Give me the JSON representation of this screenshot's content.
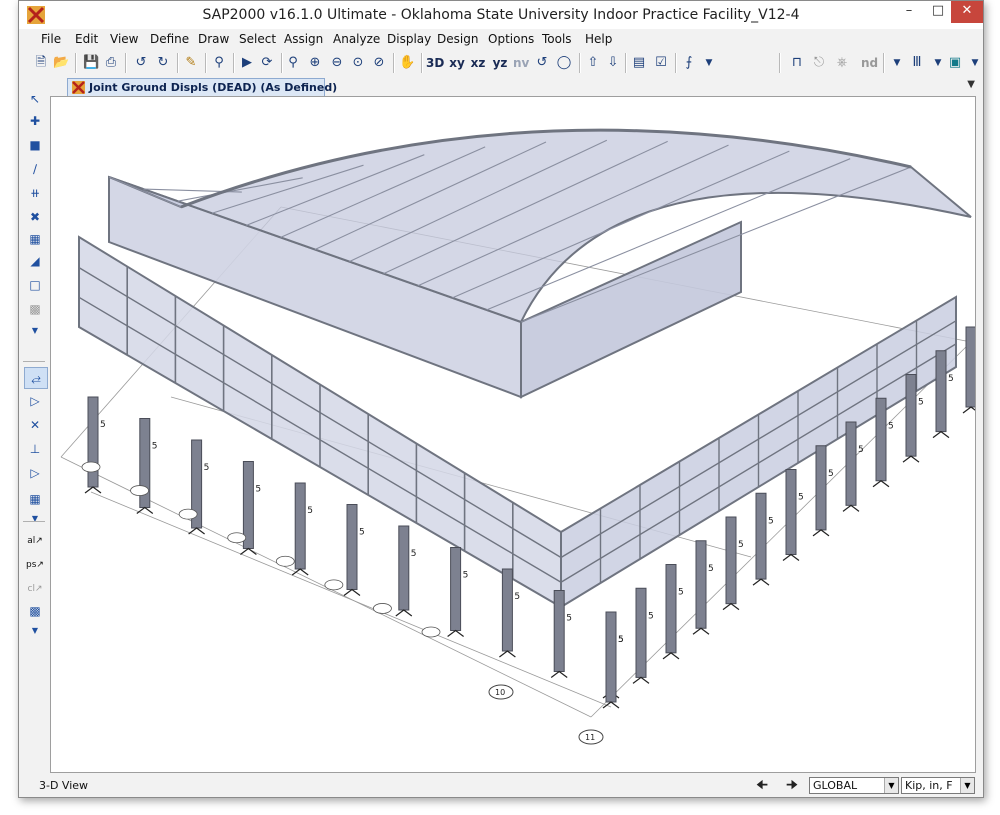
{
  "window": {
    "title": "SAP2000 v16.1.0 Ultimate  - Oklahoma State University Indoor Practice Facility_V12-4",
    "minimize_label": "–",
    "maximize_label": "□",
    "close_label": "✕"
  },
  "menu": [
    "File",
    "Edit",
    "View",
    "Define",
    "Draw",
    "Select",
    "Assign",
    "Analyze",
    "Display",
    "Design",
    "Options",
    "Tools",
    "Help"
  ],
  "toolbar": {
    "view_xy": "xy",
    "view_xz": "xz",
    "view_yz": "yz",
    "view_nv": "nv",
    "view_3d": "3D",
    "nd_label": "nd",
    "icons": [
      "new-file-icon",
      "open-file-icon",
      "save-icon",
      "print-icon",
      "undo-icon",
      "redo-icon",
      "pencil-icon",
      "lock-icon",
      "run-icon",
      "run-live-icon",
      "zoom-window-icon",
      "zoom-in-icon",
      "zoom-out-icon",
      "zoom-fit-icon",
      "zoom-previous-icon",
      "pan-icon",
      "3d-view-icon",
      "rotate-view-icon",
      "perspective-icon",
      "up-arrow-icon",
      "down-arrow-icon",
      "display-options-icon",
      "check-icon",
      "assign-icon"
    ]
  },
  "tab": {
    "label": "Joint Ground Displs (DEAD) (As Defined)"
  },
  "statusbar": {
    "view_name": "3-D View",
    "coord_system": "GLOBAL",
    "units": "Kip, in, F"
  },
  "scene": {
    "support_label": "5",
    "grid_bubbles": [
      "10",
      "11"
    ]
  },
  "colors": {
    "accent": "#c7463c",
    "structure": "#6f7480",
    "cladding": "#d3d7e6",
    "roof": "#c5c9de"
  }
}
